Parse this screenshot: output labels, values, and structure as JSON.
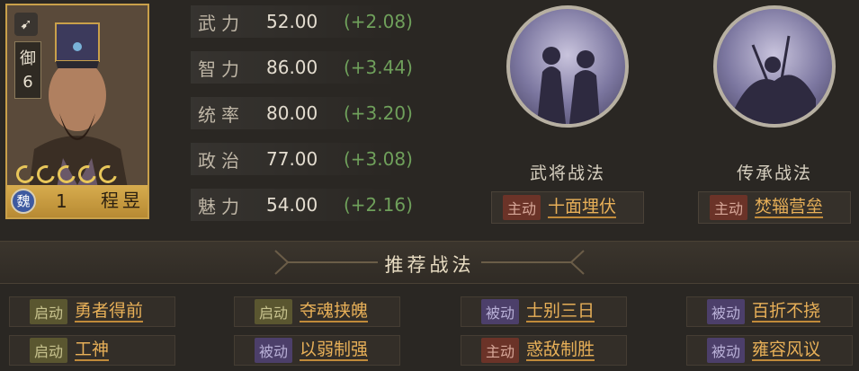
{
  "hero": {
    "troop_label": "御",
    "troop_level": "6",
    "faction": "魏",
    "level": "1",
    "name": "程昱",
    "stars": 5
  },
  "stats": [
    {
      "label": "武力",
      "value": "52.00",
      "bonus": "(+2.08)"
    },
    {
      "label": "智力",
      "value": "86.00",
      "bonus": "(+3.44)"
    },
    {
      "label": "统率",
      "value": "80.00",
      "bonus": "(+3.20)"
    },
    {
      "label": "政治",
      "value": "77.00",
      "bonus": "(+3.08)"
    },
    {
      "label": "魅力",
      "value": "54.00",
      "bonus": "(+2.16)"
    }
  ],
  "tactics": {
    "general": {
      "title": "武将战法",
      "type": "主动",
      "name": "十面埋伏"
    },
    "inherited": {
      "title": "传承战法",
      "type": "主动",
      "name": "焚辎营垒"
    }
  },
  "recommended": {
    "title": "推荐战法",
    "items": [
      {
        "type": "启动",
        "name": "勇者得前"
      },
      {
        "type": "启动",
        "name": "夺魂挟魄"
      },
      {
        "type": "被动",
        "name": "士别三日"
      },
      {
        "type": "被动",
        "name": "百折不挠"
      },
      {
        "type": "启动",
        "name": "工神"
      },
      {
        "type": "被动",
        "name": "以弱制强"
      },
      {
        "type": "主动",
        "name": "惑敌制胜"
      },
      {
        "type": "被动",
        "name": "雍容风议"
      }
    ]
  },
  "colors": {
    "active": "#6b3328",
    "passive": "#4c3f6a",
    "trigger": "#5a5630",
    "bonus": "#6fa05b",
    "tactic_name": "#e8b058",
    "card_border": "#c9a04a"
  }
}
